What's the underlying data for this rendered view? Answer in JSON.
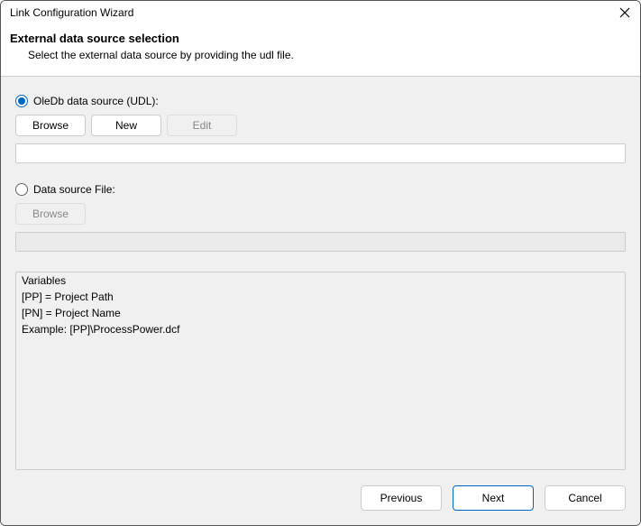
{
  "window": {
    "title": "Link Configuration Wizard"
  },
  "header": {
    "title": "External data source selection",
    "subtitle": "Select the external data source by providing the udl file."
  },
  "sourceUdl": {
    "radioLabel": "OleDb data source (UDL):",
    "browse": "Browse",
    "new": "New",
    "edit": "Edit",
    "value": ""
  },
  "sourceFile": {
    "radioLabel": "Data source File:",
    "browse": "Browse",
    "value": ""
  },
  "variables": {
    "title": "Variables",
    "lines": [
      "[PP] =   Project Path",
      "[PN] =   Project Name",
      "Example: [PP]\\ProcessPower.dcf"
    ]
  },
  "footer": {
    "previous": "Previous",
    "next": "Next",
    "cancel": "Cancel"
  }
}
